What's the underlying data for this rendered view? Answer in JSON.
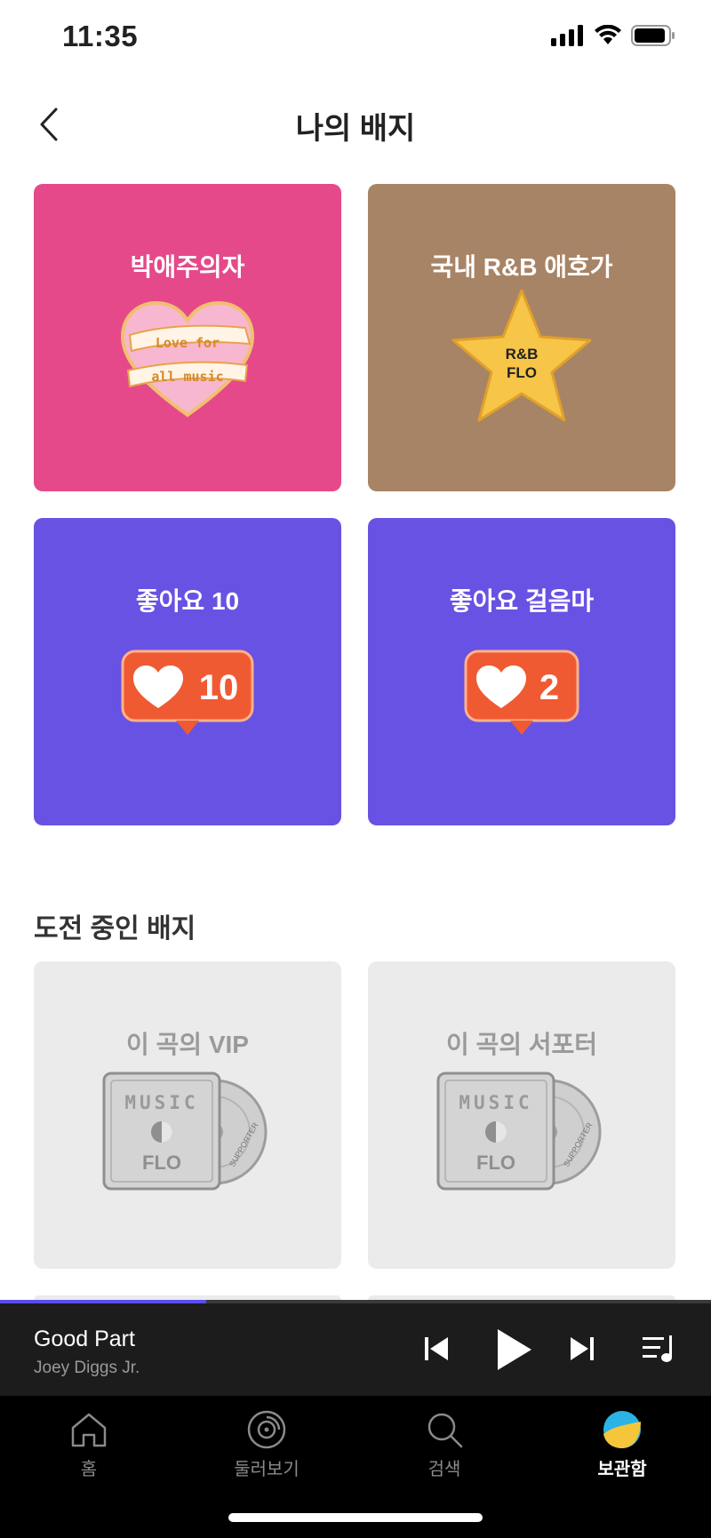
{
  "status": {
    "time": "11:35"
  },
  "header": {
    "title": "나의 배지"
  },
  "colors": {
    "pink": "#e6498a",
    "tan": "#a88466",
    "purple": "#6852e3",
    "grey_card": "#ebebeb",
    "accent": "#5b4bf0"
  },
  "earned_badges": [
    {
      "title": "박애주의자",
      "art": "heart-pin",
      "line1": "Love for",
      "line2": "all music"
    },
    {
      "title": "국내 R&B 애호가",
      "art": "star-pin",
      "line1": "R&B",
      "line2": "FLO"
    },
    {
      "title": "좋아요 10",
      "art": "like-bubble",
      "count": "10"
    },
    {
      "title": "좋아요 걸음마",
      "art": "like-bubble",
      "count": "2"
    }
  ],
  "challenge_section": {
    "title": "도전 중인 배지"
  },
  "challenge_badges": [
    {
      "title": "이 곡의 VIP",
      "art": "album-pin",
      "word": "MUSIC",
      "logo": "FLO",
      "disc": "SUPPORTER"
    },
    {
      "title": "이 곡의 서포터",
      "art": "album-pin",
      "word": "MUSIC",
      "logo": "FLO",
      "disc": "SUPPORTER"
    }
  ],
  "player": {
    "title": "Good Part",
    "artist": "Joey Diggs Jr.",
    "progress": 0.29
  },
  "tabs": [
    {
      "label": "홈",
      "icon": "home-icon"
    },
    {
      "label": "둘러보기",
      "icon": "disc-icon"
    },
    {
      "label": "검색",
      "icon": "search-icon"
    },
    {
      "label": "보관함",
      "icon": "library-avatar-icon"
    }
  ]
}
